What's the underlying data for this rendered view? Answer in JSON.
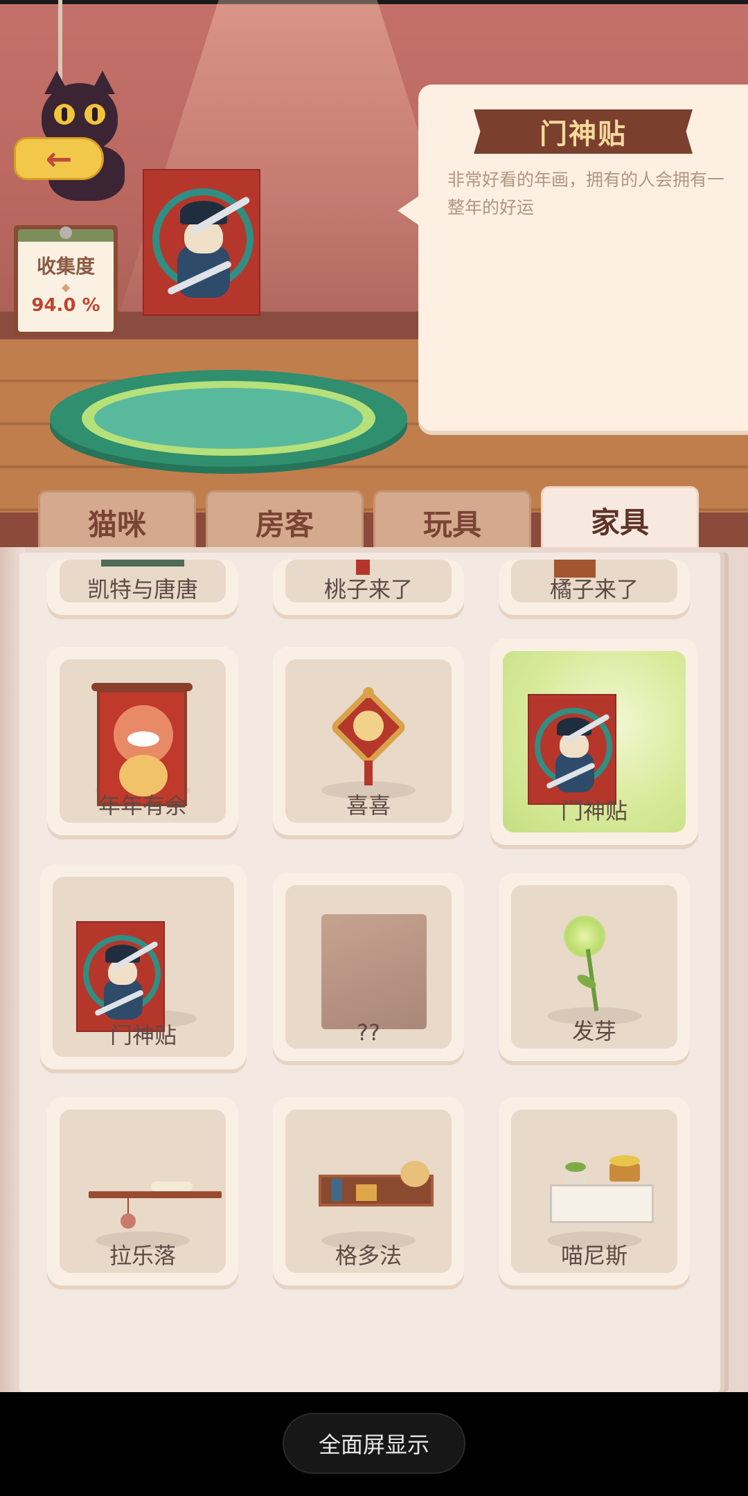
{
  "collection": {
    "title": "收集度",
    "value": "94.0 %"
  },
  "info": {
    "title": "门神贴",
    "description": "非常好看的年画，拥有的人会拥有一整年的好运"
  },
  "tabs": [
    {
      "label": "猫咪",
      "active": false
    },
    {
      "label": "房客",
      "active": false
    },
    {
      "label": "玩具",
      "active": false
    },
    {
      "label": "家具",
      "active": true
    }
  ],
  "items": [
    {
      "label": "凯特与唐唐",
      "icon": "painting-icon"
    },
    {
      "label": "桃子来了",
      "icon": "painting-icon"
    },
    {
      "label": "橘子来了",
      "icon": "painting-icon"
    },
    {
      "label": "年年有余",
      "icon": "fish-scroll-icon"
    },
    {
      "label": "喜喜",
      "icon": "lantern-ornament-icon"
    },
    {
      "label": "门神贴",
      "icon": "door-god-poster-icon",
      "selected": true
    },
    {
      "label": "门神贴",
      "icon": "door-god-poster-icon"
    },
    {
      "label": "??",
      "icon": "locked-paper-icon"
    },
    {
      "label": "发芽",
      "icon": "sprout-flower-icon"
    },
    {
      "label": "拉乐落",
      "icon": "wall-shelf-yarn-icon"
    },
    {
      "label": "格多法",
      "icon": "bookshelf-hat-icon"
    },
    {
      "label": "喵尼斯",
      "icon": "plant-shelf-icon"
    }
  ],
  "system": {
    "fullscreen_label": "全面屏显示"
  }
}
